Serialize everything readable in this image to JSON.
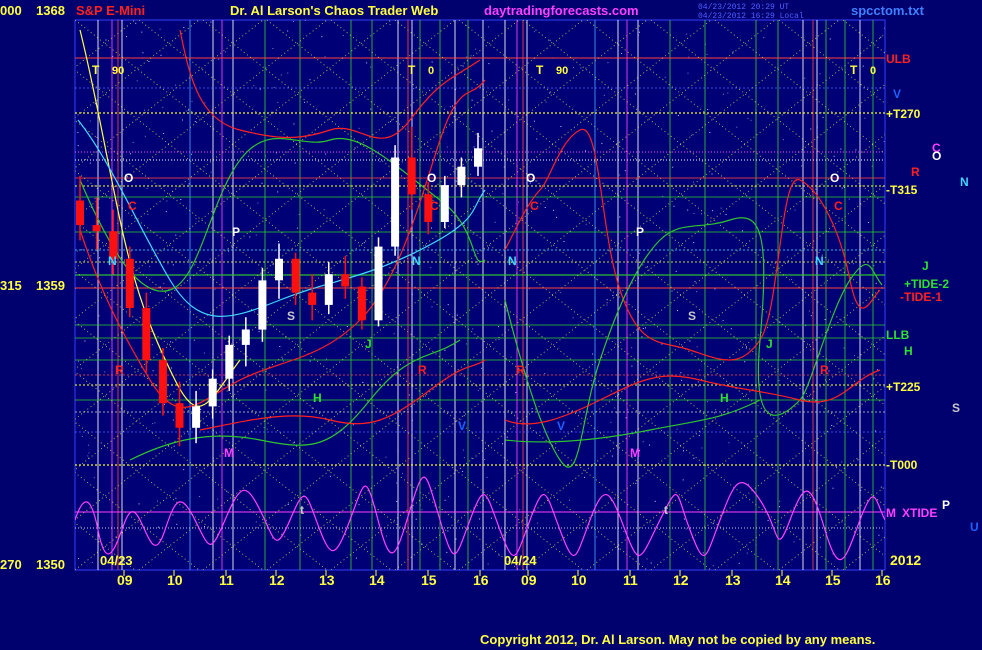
{
  "header": {
    "left_price_top": "1368",
    "left_deg_top": "000",
    "symbol": "S&P E-Mini",
    "title": "Dr. Al Larson's Chaos Trader Web",
    "site": "daytradingforecasts.com",
    "stamp_1": "04/23/2012 20:29 UT",
    "stamp_2": "04/23/2012 16:29 Local",
    "filename": "spcctom.txt",
    "year": "2012",
    "copyright": "Copyright 2012, Dr. Al Larson. May not be copied by any means."
  },
  "colors": {
    "background": "#00006e",
    "plot_bg": "#00007a",
    "grid_green": "#2fc42f",
    "grid_yellow": "#e8e84a",
    "white": "#ffffff",
    "magenta": "#ff40ff",
    "red": "#ff2020",
    "price_down": "#ff1010",
    "price_up": "#ffffff",
    "cyan": "#40d8ff"
  },
  "chart_data": {
    "type": "candlestick",
    "y_axis": {
      "ylim": [
        1350,
        1368
      ],
      "ticks": [
        {
          "deg": "000",
          "price": "1368",
          "value": 1368
        },
        {
          "deg": "315",
          "price": "1359",
          "value": 1359
        },
        {
          "deg": "270",
          "price": "1350",
          "value": 1350
        }
      ]
    },
    "x_axis": {
      "dates": [
        "04/23",
        "04/24"
      ],
      "day_1_hours": [
        "09",
        "10",
        "11",
        "12",
        "13",
        "14",
        "15",
        "16"
      ],
      "day_2_hours": [
        "09",
        "10",
        "11",
        "12",
        "13",
        "14",
        "15",
        "16"
      ]
    },
    "right_labels": [
      {
        "text": "ULB",
        "color": "#ff2020"
      },
      {
        "text": "V",
        "color": "#2060ff"
      },
      {
        "text": "+T270",
        "color": "#ffff40"
      },
      {
        "text": "C",
        "color": "#ff40ff"
      },
      {
        "text": "O",
        "color": "#ffffff"
      },
      {
        "text": "R",
        "color": "#ff2020"
      },
      {
        "text": "N",
        "color": "#40d8ff"
      },
      {
        "text": "-T315",
        "color": "#ffff40"
      },
      {
        "text": "J",
        "color": "#30e030"
      },
      {
        "text": "+TIDE-2",
        "color": "#30e030"
      },
      {
        "text": "-TIDE-1",
        "color": "#ff2020"
      },
      {
        "text": "LLB",
        "color": "#30e030"
      },
      {
        "text": "H",
        "color": "#30e030"
      },
      {
        "text": "+T225",
        "color": "#ffff40"
      },
      {
        "text": "S",
        "color": "#c8c8c8"
      },
      {
        "text": "-T000",
        "color": "#ffff40"
      },
      {
        "text": "M",
        "color": "#ff40ff"
      },
      {
        "text": "XTIDE",
        "color": "#ff40ff"
      },
      {
        "text": "P",
        "color": "#ffffff"
      },
      {
        "text": "U",
        "color": "#2060ff"
      }
    ],
    "time_markers": [
      {
        "text": "T",
        "value": "90"
      },
      {
        "text": "T",
        "value": "0"
      },
      {
        "text": "T",
        "value": "90"
      },
      {
        "text": "T",
        "value": "0"
      }
    ],
    "planet_letters": [
      "O",
      "C",
      "N",
      "P",
      "S",
      "R",
      "H",
      "M",
      "V",
      "J",
      "t"
    ],
    "candles": [
      {
        "o": 1361.8,
        "h": 1362.6,
        "l": 1360.5,
        "c": 1361.0
      },
      {
        "o": 1361.0,
        "h": 1361.9,
        "l": 1360.2,
        "c": 1360.8
      },
      {
        "o": 1360.8,
        "h": 1361.5,
        "l": 1359.4,
        "c": 1359.9
      },
      {
        "o": 1359.9,
        "h": 1360.3,
        "l": 1358.0,
        "c": 1358.3
      },
      {
        "o": 1358.3,
        "h": 1358.8,
        "l": 1356.2,
        "c": 1356.6
      },
      {
        "o": 1356.6,
        "h": 1357.0,
        "l": 1354.8,
        "c": 1355.2
      },
      {
        "o": 1355.2,
        "h": 1355.9,
        "l": 1353.8,
        "c": 1354.4
      },
      {
        "o": 1354.4,
        "h": 1355.6,
        "l": 1353.9,
        "c": 1355.1
      },
      {
        "o": 1355.1,
        "h": 1356.3,
        "l": 1354.7,
        "c": 1356.0
      },
      {
        "o": 1356.0,
        "h": 1357.4,
        "l": 1355.6,
        "c": 1357.1
      },
      {
        "o": 1357.1,
        "h": 1358.0,
        "l": 1356.4,
        "c": 1357.6
      },
      {
        "o": 1357.6,
        "h": 1359.6,
        "l": 1357.2,
        "c": 1359.2
      },
      {
        "o": 1359.2,
        "h": 1360.4,
        "l": 1358.6,
        "c": 1359.9
      },
      {
        "o": 1359.9,
        "h": 1360.1,
        "l": 1358.4,
        "c": 1358.8
      },
      {
        "o": 1358.8,
        "h": 1359.4,
        "l": 1357.9,
        "c": 1358.4
      },
      {
        "o": 1358.4,
        "h": 1359.8,
        "l": 1358.1,
        "c": 1359.4
      },
      {
        "o": 1359.4,
        "h": 1360.0,
        "l": 1358.6,
        "c": 1359.0
      },
      {
        "o": 1359.0,
        "h": 1359.3,
        "l": 1357.6,
        "c": 1357.9
      },
      {
        "o": 1357.9,
        "h": 1360.6,
        "l": 1357.7,
        "c": 1360.3
      },
      {
        "o": 1360.3,
        "h": 1363.6,
        "l": 1360.0,
        "c": 1363.2
      },
      {
        "o": 1363.2,
        "h": 1364.2,
        "l": 1361.5,
        "c": 1362.0
      },
      {
        "o": 1362.0,
        "h": 1362.4,
        "l": 1360.7,
        "c": 1361.1
      },
      {
        "o": 1361.1,
        "h": 1362.6,
        "l": 1360.9,
        "c": 1362.3
      },
      {
        "o": 1362.3,
        "h": 1363.2,
        "l": 1361.9,
        "c": 1362.9
      },
      {
        "o": 1362.9,
        "h": 1364.0,
        "l": 1362.6,
        "c": 1363.5
      }
    ]
  }
}
